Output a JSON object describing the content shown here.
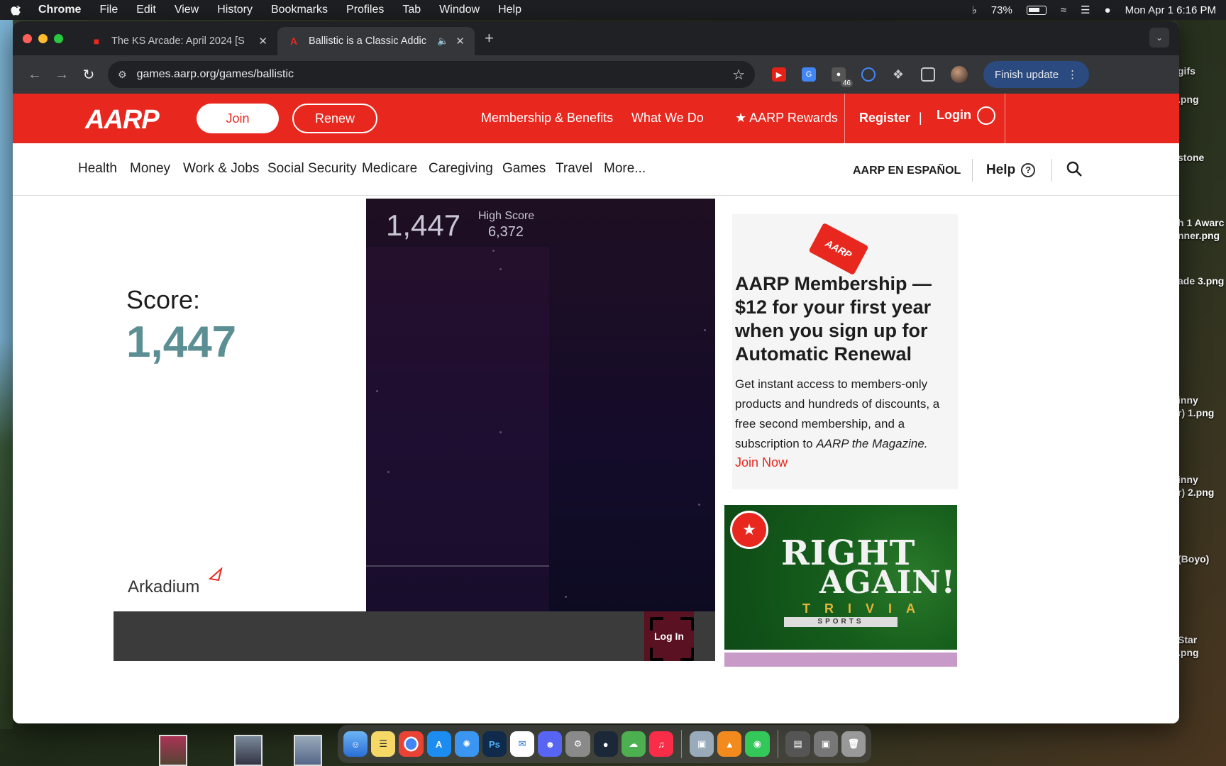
{
  "menubar": {
    "app": "Chrome",
    "items": [
      "File",
      "Edit",
      "View",
      "History",
      "Bookmarks",
      "Profiles",
      "Tab",
      "Window",
      "Help"
    ],
    "battery": "73%",
    "datetime": "Mon Apr 1  6:16 PM"
  },
  "desktop_labels": [
    "gifs",
    ".png",
    "stone",
    "h 1 Awarc",
    "nner.png",
    "ade 3.png",
    "inny",
    "r) 1.png",
    "inny",
    "r) 2.png",
    "(Boyo)",
    "Star",
    ".png"
  ],
  "browser": {
    "tabs": [
      {
        "title": "The KS Arcade: April 2024 [S",
        "active": false
      },
      {
        "title": "Ballistic is a Classic Addic",
        "active": true
      }
    ],
    "url": "games.aarp.org/games/ballistic",
    "extension_badge": "46",
    "finish_update": "Finish update"
  },
  "aarp": {
    "logo": "AARP",
    "join": "Join",
    "renew": "Renew",
    "top_links": {
      "membership": "Membership & Benefits",
      "what_we_do": "What We Do",
      "rewards": "AARP Rewards",
      "register": "Register",
      "login": "Login"
    },
    "nav": [
      "Health",
      "Money",
      "Work & Jobs",
      "Social Security",
      "Medicare",
      "Caregiving",
      "Games",
      "Travel",
      "More..."
    ],
    "espanol": "AARP EN ESPAÑOL",
    "help": "Help"
  },
  "game": {
    "score_label": "Score:",
    "score": "1,447",
    "in_game_score": "1,447",
    "high_score_label": "High Score",
    "high_score": "6,372",
    "brand": "Arkadium",
    "login": "Log In"
  },
  "promo": {
    "card_text": "AARP",
    "headline": "AARP Membership — $12 for your first year when you sign up for Automatic Renewal",
    "body": "Get instant access to members-only products and hundreds of discounts, a free second membership, and a subscription to ",
    "magazine": "AARP the Magazine.",
    "cta": "Join Now"
  },
  "trivia_ad": {
    "line1": "RIGHT",
    "line2": "AGAIN!",
    "line3": "TRIVIA",
    "line4": "SPORTS"
  }
}
